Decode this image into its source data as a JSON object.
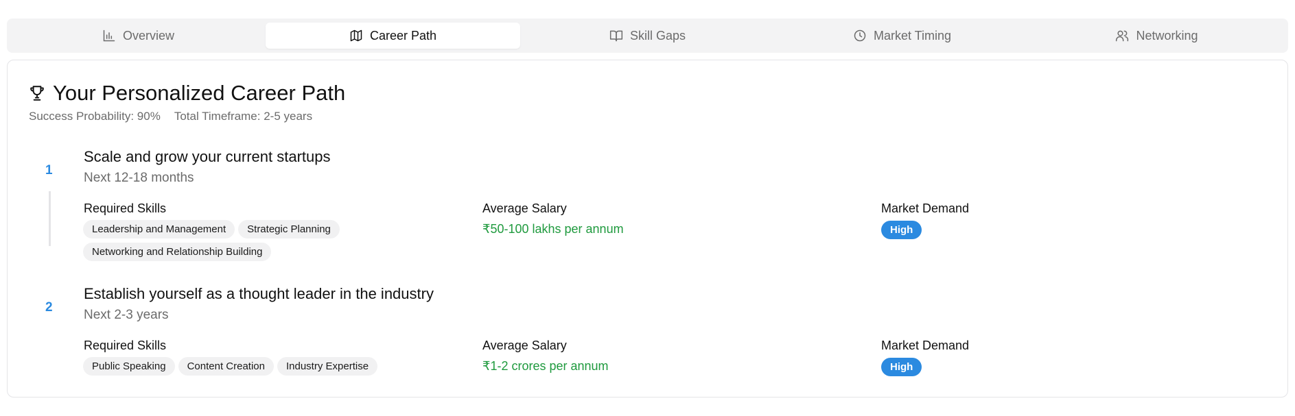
{
  "tabs": [
    {
      "label": "Overview",
      "icon": "bar-chart-icon",
      "active": false
    },
    {
      "label": "Career Path",
      "icon": "map-icon",
      "active": true
    },
    {
      "label": "Skill Gaps",
      "icon": "book-icon",
      "active": false
    },
    {
      "label": "Market Timing",
      "icon": "clock-icon",
      "active": false
    },
    {
      "label": "Networking",
      "icon": "users-icon",
      "active": false
    }
  ],
  "header": {
    "title": "Your Personalized Career Path",
    "icon": "trophy-icon",
    "success_probability": "Success Probability: 90%",
    "total_timeframe": "Total Timeframe: 2-5 years"
  },
  "labels": {
    "required_skills": "Required Skills",
    "average_salary": "Average Salary",
    "market_demand": "Market Demand"
  },
  "steps": [
    {
      "number": "1",
      "title": "Scale and grow your current startups",
      "timeframe": "Next 12-18 months",
      "skills": [
        "Leadership and Management",
        "Strategic Planning",
        "Networking and Relationship Building"
      ],
      "salary": "₹50-100 lakhs per annum",
      "demand": "High"
    },
    {
      "number": "2",
      "title": "Establish yourself as a thought leader in the industry",
      "timeframe": "Next 2-3 years",
      "skills": [
        "Public Speaking",
        "Content Creation",
        "Industry Expertise"
      ],
      "salary": "₹1-2 crores per annum",
      "demand": "High"
    }
  ],
  "colors": {
    "accent": "#2b8ae0",
    "salary": "#1f9a3e",
    "muted": "#6b6b6b"
  }
}
